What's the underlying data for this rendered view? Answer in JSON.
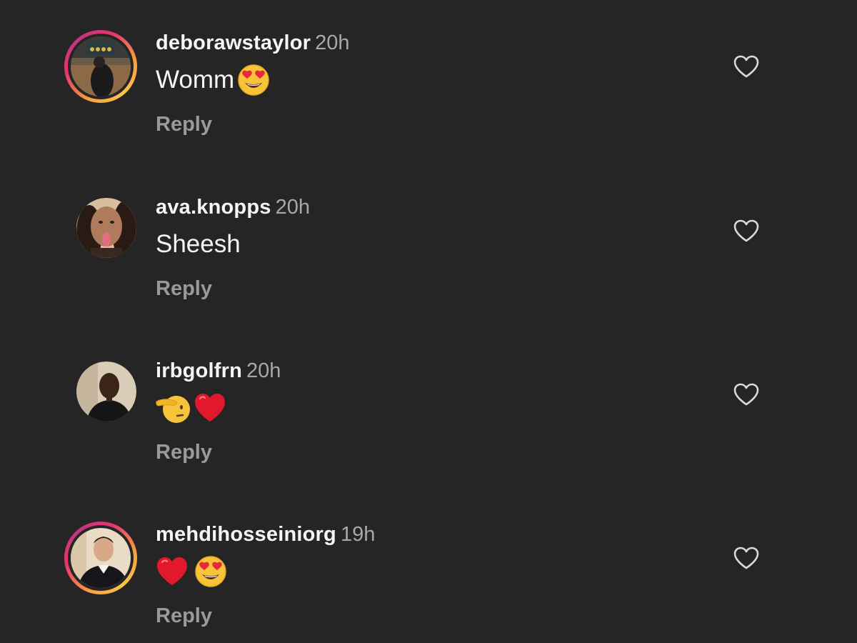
{
  "comments": [
    {
      "username": "deborawstaylor",
      "time": "20h",
      "text": "Womm",
      "emojis": [
        "heart-eyes-emoji"
      ],
      "reply_label": "Reply",
      "has_story": true
    },
    {
      "username": "ava.knopps",
      "time": "20h",
      "text": "Sheesh",
      "emojis": [],
      "reply_label": "Reply",
      "has_story": false
    },
    {
      "username": "irbgolfrn",
      "time": "20h",
      "text": "",
      "emojis": [
        "saluting-face-emoji",
        "red-heart-emoji"
      ],
      "reply_label": "Reply",
      "has_story": false
    },
    {
      "username": "mehdihosseiniorg",
      "time": "19h",
      "text": "",
      "emojis": [
        "red-heart-emoji",
        "heart-eyes-emoji"
      ],
      "reply_label": "Reply",
      "has_story": true
    }
  ],
  "icons": {
    "like": "heart-outline-icon"
  },
  "colors": {
    "background": "#252525",
    "username": "#f5f5f5",
    "timestamp": "#a8a8a8",
    "reply": "#9a9a9a",
    "story_ring_start": "#f9a03f",
    "story_ring_end": "#c13584"
  }
}
